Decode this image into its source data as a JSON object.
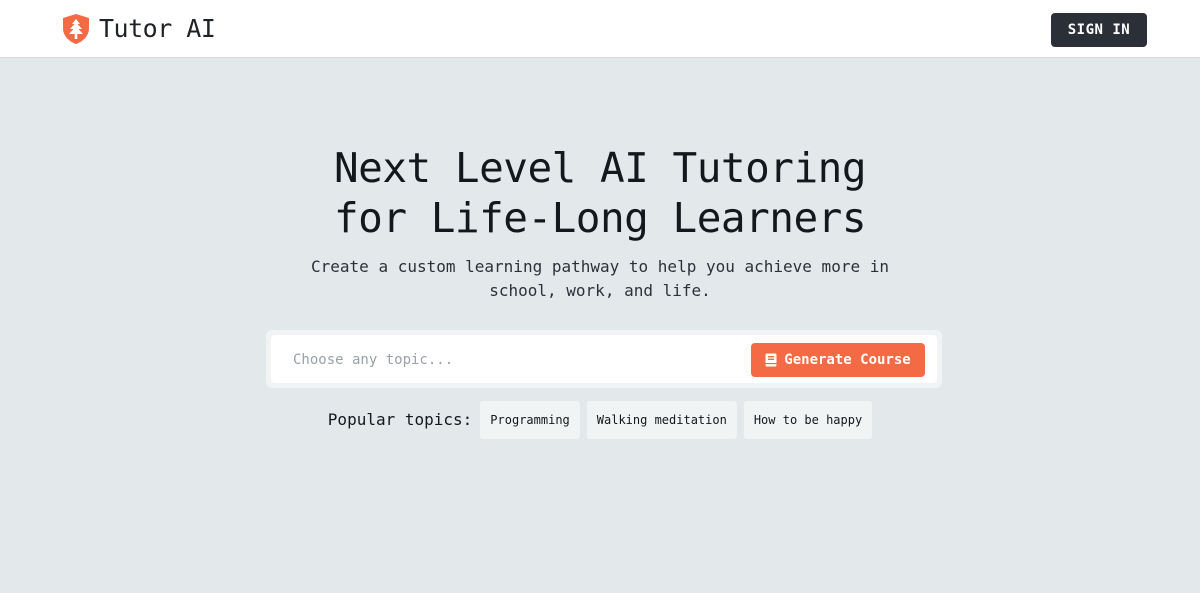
{
  "header": {
    "brand_name": "Tutor AI",
    "brand_icon": "shield-tree-icon",
    "signin_label": "SIGN IN"
  },
  "hero": {
    "headline_line1": "Next Level AI Tutoring",
    "headline_line2": "for Life-Long Learners",
    "subhead_line1": "Create a custom learning pathway to help you achieve more in",
    "subhead_line2": "school, work, and life."
  },
  "search": {
    "placeholder": "Choose any topic...",
    "value": "",
    "button_label": "Generate Course",
    "button_icon": "book-icon"
  },
  "topics": {
    "label": "Popular topics:",
    "items": [
      "Programming",
      "Walking meditation",
      "How to be happy"
    ]
  },
  "colors": {
    "accent": "#f46a45",
    "signin_bg": "#2b3038",
    "hero_bg": "#e3e9eb"
  }
}
